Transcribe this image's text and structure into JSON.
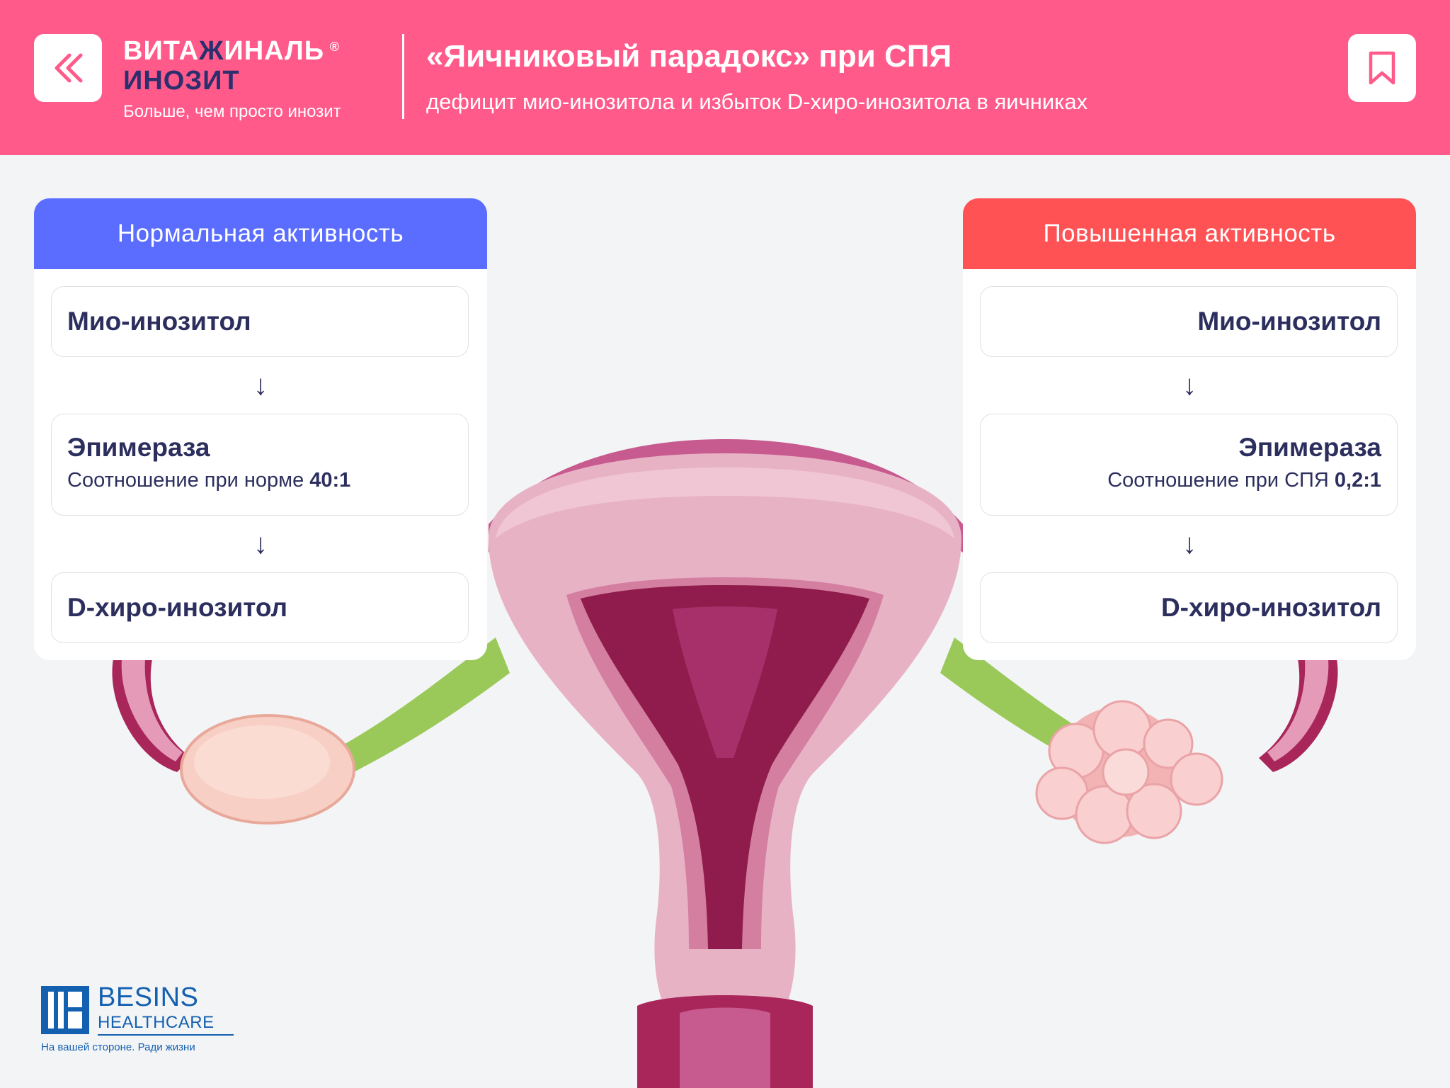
{
  "header": {
    "brand_line1_a": "ВИТА",
    "brand_line1_b": "Ж",
    "brand_line1_c": "ИНАЛЬ",
    "brand_reg": "®",
    "brand_line2": "ИНОЗИТ",
    "tagline": "Больше, чем просто инозит",
    "title": "«Яичниковый парадокс» при СПЯ",
    "subtitle": "дефицит мио-инозитола и избыток D-хиро-инозитола в яичниках"
  },
  "left_panel": {
    "heading": "Нормальная активность",
    "step1": "Мио-инозитол",
    "step2": "Эпимераза",
    "ratio_label": "Соотношение при норме ",
    "ratio_value": "40:1",
    "step3": "D-хиро-инозитол",
    "arrow": "↓"
  },
  "right_panel": {
    "heading": "Повышенная активность",
    "step1": "Мио-инозитол",
    "step2": "Эпимераза",
    "ratio_label": "Соотношение при СПЯ ",
    "ratio_value": "0,2:1",
    "step3": "D-хиро-инозитол",
    "arrow": "↓"
  },
  "footer_logo": {
    "name": "BESINS",
    "sub": "HEALTHCARE",
    "tagline": "На вашей стороне. Ради жизни"
  },
  "colors": {
    "header_bg": "#ff5a8a",
    "normal_head": "#5b6dff",
    "elevated_head": "#ff5255",
    "text_dark": "#2c2f5e"
  }
}
